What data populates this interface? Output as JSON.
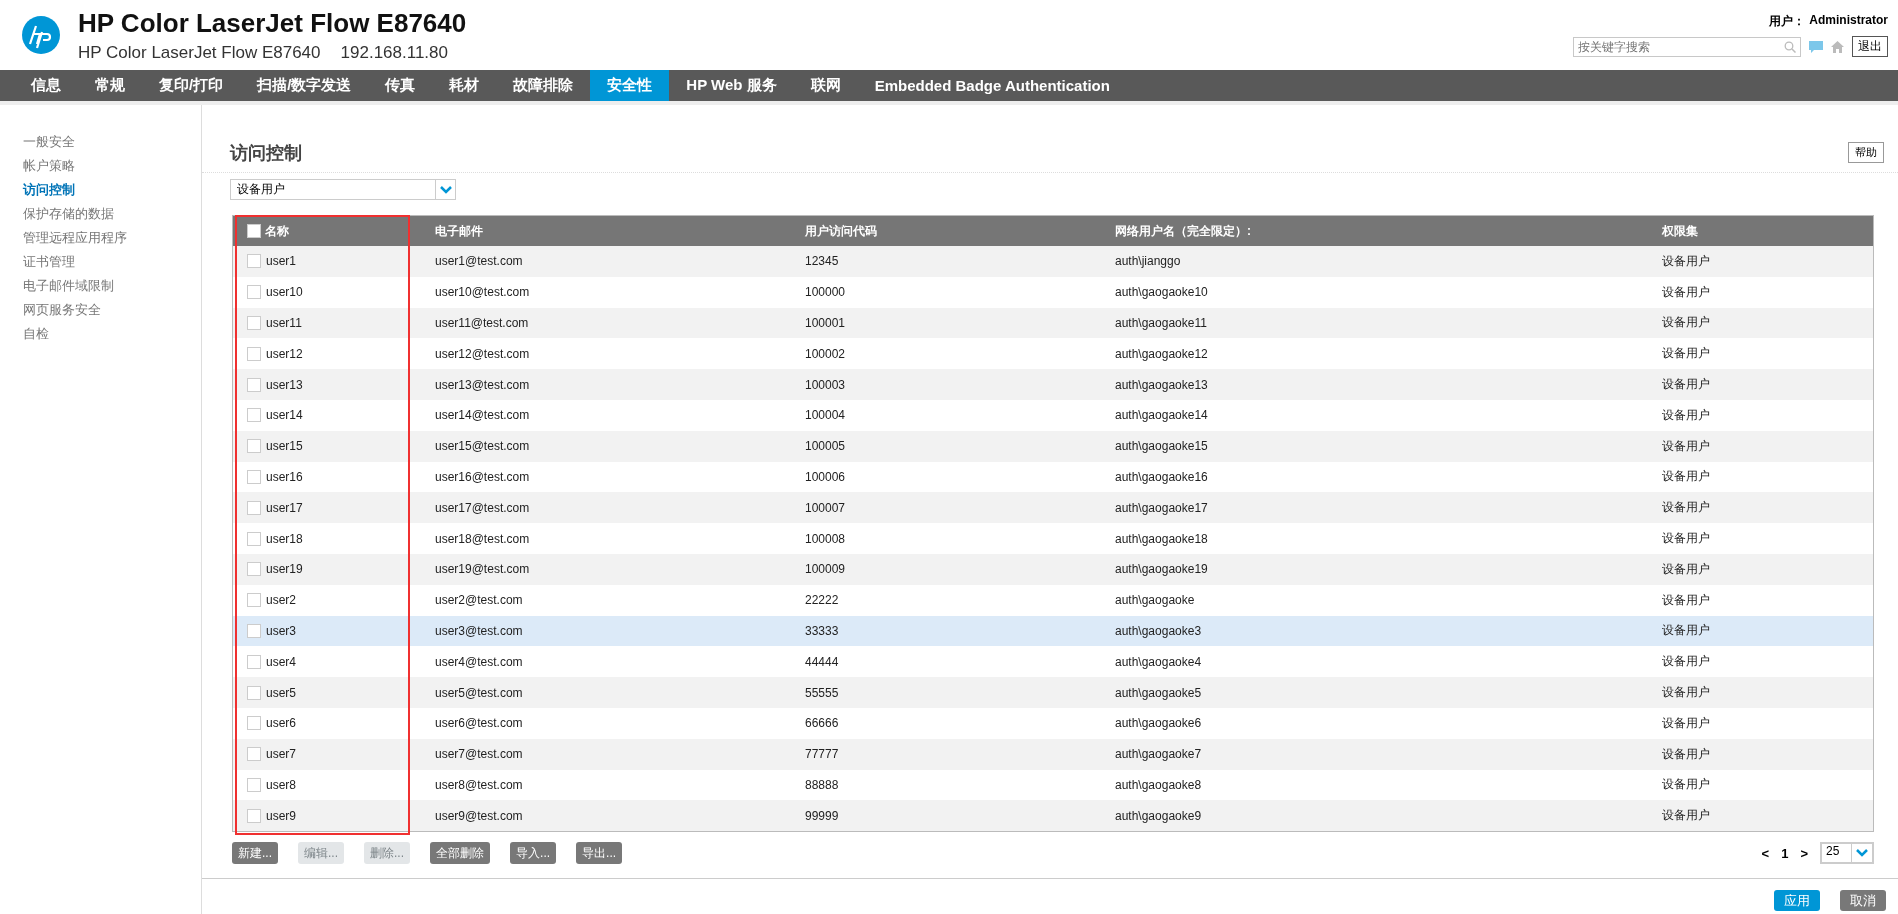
{
  "header": {
    "title": "HP Color LaserJet Flow E87640",
    "subtitle": "HP Color LaserJet Flow E87640",
    "ip": "192.168.11.80",
    "user_label": "用户：",
    "user_name": "Administrator",
    "search": {
      "placeholder": "按关键字搜索"
    },
    "logout": "退出"
  },
  "nav": [
    {
      "label": "信息",
      "selected": false
    },
    {
      "label": "常规",
      "selected": false
    },
    {
      "label": "复印/打印",
      "selected": false
    },
    {
      "label": "扫描/数字发送",
      "selected": false
    },
    {
      "label": "传真",
      "selected": false
    },
    {
      "label": "耗材",
      "selected": false
    },
    {
      "label": "故障排除",
      "selected": false
    },
    {
      "label": "安全性",
      "selected": true
    },
    {
      "label": "HP Web 服务",
      "selected": false
    },
    {
      "label": "联网",
      "selected": false
    },
    {
      "label": "Embedded Badge Authentication",
      "selected": false
    }
  ],
  "sidebar": {
    "items": [
      {
        "label": "一般安全",
        "selected": false
      },
      {
        "label": "帐户策略",
        "selected": false
      },
      {
        "label": "访问控制",
        "selected": true
      },
      {
        "label": "保护存储的数据",
        "selected": false
      },
      {
        "label": "管理远程应用程序",
        "selected": false
      },
      {
        "label": "证书管理",
        "selected": false
      },
      {
        "label": "电子邮件域限制",
        "selected": false
      },
      {
        "label": "网页服务安全",
        "selected": false
      },
      {
        "label": "自检",
        "selected": false
      }
    ]
  },
  "page": {
    "title": "访问控制",
    "help": "帮助",
    "filter": "设备用户"
  },
  "table": {
    "header_checked": false,
    "columns": [
      "名称",
      "电子邮件",
      "用户访问代码",
      "网络用户名（完全限定）:",
      "权限集"
    ],
    "rows": [
      {
        "checked": false,
        "selected": false,
        "cells": [
          "user1",
          "user1@test.com",
          "12345",
          "auth\\jianggo",
          "设备用户"
        ]
      },
      {
        "checked": false,
        "selected": false,
        "cells": [
          "user10",
          "user10@test.com",
          "100000",
          "auth\\gaogaoke10",
          "设备用户"
        ]
      },
      {
        "checked": false,
        "selected": false,
        "cells": [
          "user11",
          "user11@test.com",
          "100001",
          "auth\\gaogaoke11",
          "设备用户"
        ]
      },
      {
        "checked": false,
        "selected": false,
        "cells": [
          "user12",
          "user12@test.com",
          "100002",
          "auth\\gaogaoke12",
          "设备用户"
        ]
      },
      {
        "checked": false,
        "selected": false,
        "cells": [
          "user13",
          "user13@test.com",
          "100003",
          "auth\\gaogaoke13",
          "设备用户"
        ]
      },
      {
        "checked": false,
        "selected": false,
        "cells": [
          "user14",
          "user14@test.com",
          "100004",
          "auth\\gaogaoke14",
          "设备用户"
        ]
      },
      {
        "checked": false,
        "selected": false,
        "cells": [
          "user15",
          "user15@test.com",
          "100005",
          "auth\\gaogaoke15",
          "设备用户"
        ]
      },
      {
        "checked": false,
        "selected": false,
        "cells": [
          "user16",
          "user16@test.com",
          "100006",
          "auth\\gaogaoke16",
          "设备用户"
        ]
      },
      {
        "checked": false,
        "selected": false,
        "cells": [
          "user17",
          "user17@test.com",
          "100007",
          "auth\\gaogaoke17",
          "设备用户"
        ]
      },
      {
        "checked": false,
        "selected": false,
        "cells": [
          "user18",
          "user18@test.com",
          "100008",
          "auth\\gaogaoke18",
          "设备用户"
        ]
      },
      {
        "checked": false,
        "selected": false,
        "cells": [
          "user19",
          "user19@test.com",
          "100009",
          "auth\\gaogaoke19",
          "设备用户"
        ]
      },
      {
        "checked": false,
        "selected": false,
        "cells": [
          "user2",
          "user2@test.com",
          "22222",
          "auth\\gaogaoke",
          "设备用户"
        ]
      },
      {
        "checked": false,
        "selected": true,
        "cells": [
          "user3",
          "user3@test.com",
          "33333",
          "auth\\gaogaoke3",
          "设备用户"
        ]
      },
      {
        "checked": false,
        "selected": false,
        "cells": [
          "user4",
          "user4@test.com",
          "44444",
          "auth\\gaogaoke4",
          "设备用户"
        ]
      },
      {
        "checked": false,
        "selected": false,
        "cells": [
          "user5",
          "user5@test.com",
          "55555",
          "auth\\gaogaoke5",
          "设备用户"
        ]
      },
      {
        "checked": false,
        "selected": false,
        "cells": [
          "user6",
          "user6@test.com",
          "66666",
          "auth\\gaogaoke6",
          "设备用户"
        ]
      },
      {
        "checked": false,
        "selected": false,
        "cells": [
          "user7",
          "user7@test.com",
          "77777",
          "auth\\gaogaoke7",
          "设备用户"
        ]
      },
      {
        "checked": false,
        "selected": false,
        "cells": [
          "user8",
          "user8@test.com",
          "88888",
          "auth\\gaogaoke8",
          "设备用户"
        ]
      },
      {
        "checked": false,
        "selected": false,
        "cells": [
          "user9",
          "user9@test.com",
          "99999",
          "auth\\gaogaoke9",
          "设备用户"
        ]
      }
    ]
  },
  "actions": [
    {
      "label": "新建...",
      "disabled": false
    },
    {
      "label": "编辑...",
      "disabled": true
    },
    {
      "label": "删除...",
      "disabled": true
    },
    {
      "label": "全部删除",
      "disabled": false
    },
    {
      "label": "导入...",
      "disabled": false
    },
    {
      "label": "导出...",
      "disabled": false
    }
  ],
  "pagination": {
    "prev": "<",
    "page": "1",
    "next": ">",
    "page_size": "25"
  },
  "footer": [
    {
      "label": "应用",
      "kind": "primary"
    },
    {
      "label": "取消",
      "kind": "secondary"
    }
  ]
}
